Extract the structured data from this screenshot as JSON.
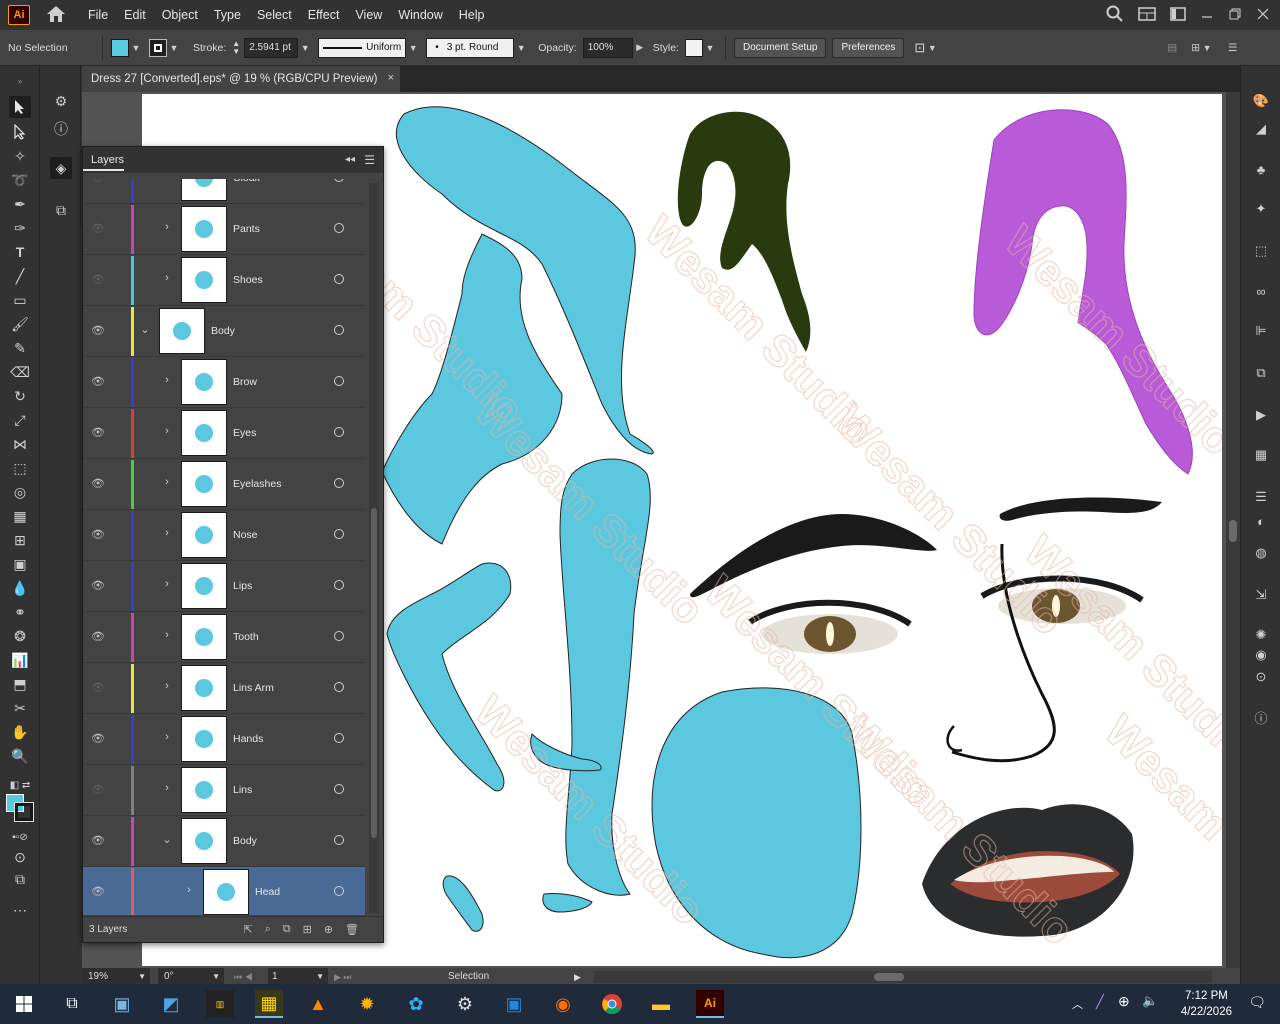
{
  "app": {
    "logo": "Ai",
    "menu": [
      "File",
      "Edit",
      "Object",
      "Type",
      "Select",
      "Effect",
      "View",
      "Window",
      "Help"
    ]
  },
  "control_bar": {
    "selection_status": "No Selection",
    "stroke_label": "Stroke:",
    "stroke_weight": "2.5941 pt",
    "profile": "Uniform",
    "brush": "3 pt. Round",
    "opacity_label": "Opacity:",
    "opacity": "100%",
    "style_label": "Style:",
    "document_setup": "Document Setup",
    "preferences": "Preferences",
    "fill_color": "#5cc8e0"
  },
  "document": {
    "tab_title": "Dress 27 [Converted].eps* @ 19 % (RGB/CPU Preview)",
    "close_glyph": "×"
  },
  "layers_panel": {
    "title": "Layers",
    "count": "3 Layers",
    "layers": [
      {
        "name": "Cloak",
        "visible": false,
        "color": "#3b3bd1",
        "indent": 1,
        "expanded": false
      },
      {
        "name": "Pants",
        "visible": false,
        "color": "#d43fb3",
        "indent": 1,
        "expanded": false
      },
      {
        "name": "Shoes",
        "visible": false,
        "color": "#3fd1d1",
        "indent": 1,
        "expanded": false
      },
      {
        "name": "Body",
        "visible": true,
        "color": "#e6e63f",
        "indent": 0,
        "expanded": true
      },
      {
        "name": "Brow",
        "visible": true,
        "color": "#3b3bd1",
        "indent": 1,
        "expanded": false
      },
      {
        "name": "Eyes",
        "visible": true,
        "color": "#d43f3f",
        "indent": 1,
        "expanded": false
      },
      {
        "name": "Eyelashes",
        "visible": true,
        "color": "#3fd13f",
        "indent": 1,
        "expanded": false
      },
      {
        "name": "Nose",
        "visible": true,
        "color": "#3b3bd1",
        "indent": 1,
        "expanded": false
      },
      {
        "name": "Lips",
        "visible": true,
        "color": "#3b3bd1",
        "indent": 1,
        "expanded": false
      },
      {
        "name": "Tooth",
        "visible": true,
        "color": "#d43fb3",
        "indent": 1,
        "expanded": false
      },
      {
        "name": "Lins Arm",
        "visible": false,
        "color": "#e6e63f",
        "indent": 1,
        "expanded": false
      },
      {
        "name": "Hands",
        "visible": true,
        "color": "#3b3bd1",
        "indent": 1,
        "expanded": false
      },
      {
        "name": "Lins",
        "visible": false,
        "color": "#7f7f7f",
        "indent": 1,
        "expanded": false
      },
      {
        "name": "Body",
        "visible": true,
        "color": "#d43fb3",
        "indent": 1,
        "expanded": true
      },
      {
        "name": "Head",
        "visible": true,
        "color": "#e65c5c",
        "indent": 2,
        "expanded": false,
        "selected": true
      }
    ]
  },
  "status_bar": {
    "zoom": "19%",
    "rotation": "0°",
    "artboard": "1",
    "mode": "Selection"
  },
  "watermark": "Wesam Studio",
  "taskbar": {
    "time": "7:12 PM",
    "date": "4/22/2026"
  }
}
